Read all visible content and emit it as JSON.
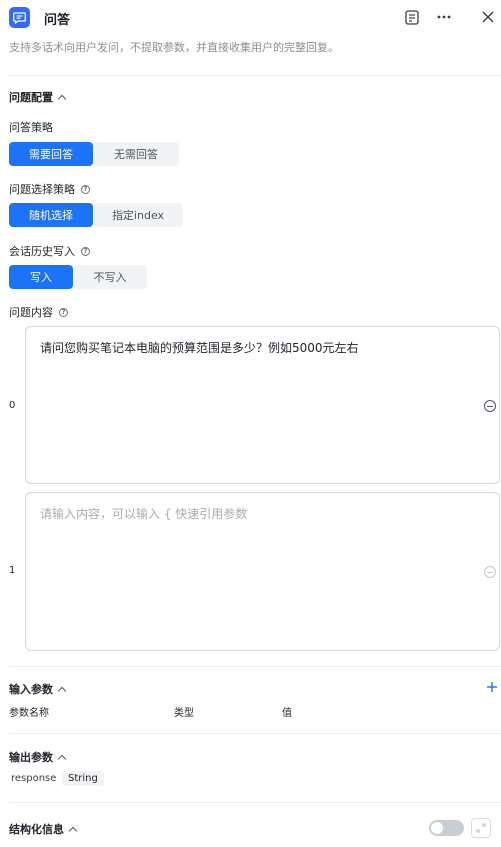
{
  "header": {
    "title": "问答",
    "icon": "chat-bubble-icon",
    "accent": "#2f6bff"
  },
  "description": "支持多话术向用户发问，不提取参数，并直接收集用户的完整回复。",
  "question_config": {
    "title": "问题配置",
    "answer_strategy": {
      "label": "问答策略",
      "options": [
        "需要回答",
        "无需回答"
      ],
      "selected": "需要回答"
    },
    "select_strategy": {
      "label": "问题选择策略",
      "options": [
        "随机选择",
        "指定index"
      ],
      "selected": "随机选择"
    },
    "history_write": {
      "label": "会话历史写入",
      "options": [
        "写入",
        "不写入"
      ],
      "selected": "写入"
    },
    "content": {
      "label": "问题内容",
      "items": [
        {
          "index": "0",
          "value": "请问您购买笔记本电脑的预算范围是多少？例如5000元左右",
          "placeholder": ""
        },
        {
          "index": "1",
          "value": "",
          "placeholder": "请输入内容，可以输入 { 快速引用参数"
        }
      ]
    }
  },
  "input_params": {
    "title": "输入参数",
    "columns": [
      "参数名称",
      "类型",
      "值"
    ]
  },
  "output_params": {
    "title": "输出参数",
    "items": [
      {
        "name": "response",
        "type": "String"
      }
    ]
  },
  "structured": {
    "title": "结构化信息",
    "enabled": false
  }
}
